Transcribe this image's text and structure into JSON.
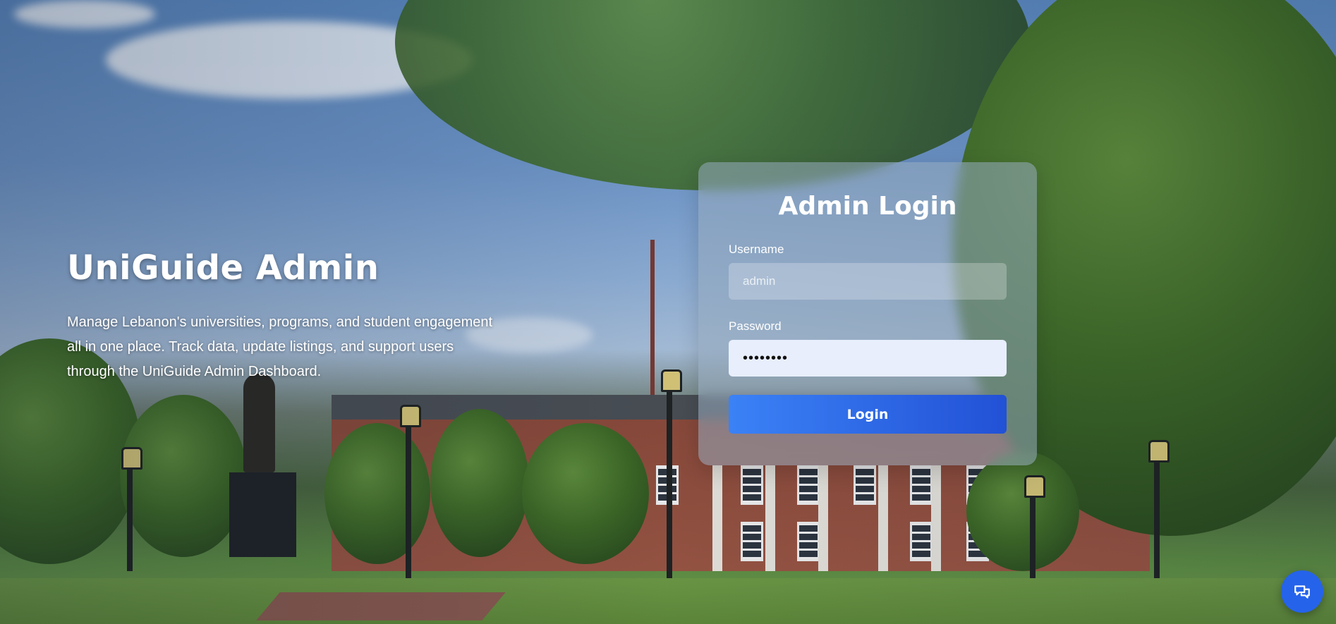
{
  "hero": {
    "title": "UniGuide Admin",
    "description": "Manage Lebanon's universities, programs, and student engagement all in one place. Track data, update listings, and support users through the UniGuide Admin Dashboard."
  },
  "login": {
    "title": "Admin Login",
    "username_label": "Username",
    "username_placeholder": "admin",
    "password_label": "Password",
    "password_value": "••••••••",
    "submit_label": "Login"
  },
  "chat": {
    "icon": "chat-icon"
  },
  "colors": {
    "accent": "#2563eb",
    "button_gradient_start": "#3b82f6",
    "button_gradient_end": "#2251d6",
    "text": "#ffffff"
  }
}
